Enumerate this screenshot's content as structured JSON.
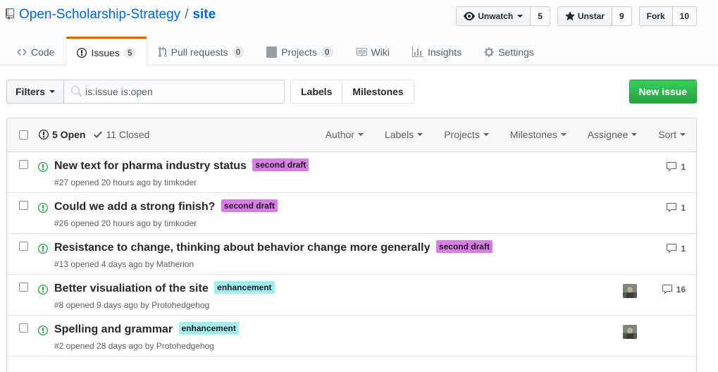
{
  "repo": {
    "owner": "Open-Scholarship-Strategy",
    "separator": "/",
    "name": "site"
  },
  "actions": {
    "watch": {
      "label": "Unwatch",
      "count": "5"
    },
    "star": {
      "label": "Unstar",
      "count": "9"
    },
    "fork": {
      "label": "Fork",
      "count": "10"
    }
  },
  "nav": {
    "code": "Code",
    "issues": "Issues",
    "issues_count": "5",
    "pulls": "Pull requests",
    "pulls_count": "0",
    "projects": "Projects",
    "projects_count": "0",
    "wiki": "Wiki",
    "insights": "Insights",
    "settings": "Settings"
  },
  "subnav": {
    "filters": "Filters",
    "search_value": "is:issue is:open",
    "labels": "Labels",
    "milestones": "Milestones",
    "new_issue": "New issue"
  },
  "list_header": {
    "open": "5 Open",
    "closed": "11 Closed",
    "filters": [
      "Author",
      "Labels",
      "Projects",
      "Milestones",
      "Assignee",
      "Sort"
    ]
  },
  "colors": {
    "second_draft": "#d97ce8",
    "enhancement": "#a2eeef",
    "open_green": "#28a745",
    "tab_accent": "#e36209"
  },
  "issues": [
    {
      "title": "New text for pharma industry status",
      "label": "second draft",
      "meta_prefix": "#27 opened 20 hours ago by ",
      "author": "timkoder",
      "comments": "1",
      "assignee": false
    },
    {
      "title": "Could we add a strong finish?",
      "label": "second draft",
      "meta_prefix": "#26 opened 20 hours ago by ",
      "author": "timkoder",
      "comments": "1",
      "assignee": false
    },
    {
      "title": "Resistance to change, thinking about behavior change more generally",
      "label": "second draft",
      "meta_prefix": "#13 opened 4 days ago by ",
      "author": "Matherion",
      "comments": "1",
      "assignee": false
    },
    {
      "title": "Better visualiation of the site",
      "label": "enhancement",
      "meta_prefix": "#8 opened 9 days ago by ",
      "author": "Protohedgehog",
      "comments": "16",
      "assignee": true
    },
    {
      "title": "Spelling and grammar",
      "label": "enhancement",
      "meta_prefix": "#2 opened 28 days ago by ",
      "author": "Protohedgehog",
      "comments": "",
      "assignee": true
    }
  ]
}
